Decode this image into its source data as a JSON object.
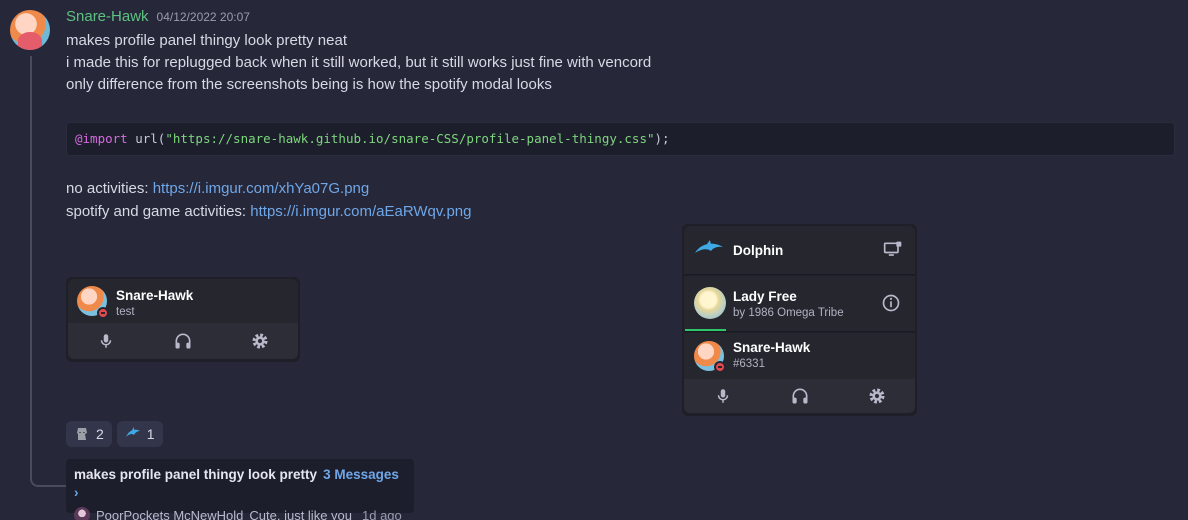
{
  "message": {
    "username": "Snare-Hawk",
    "timestamp": "04/12/2022 20:07",
    "lines": [
      "makes profile panel thingy look pretty neat",
      "i made this for replugged back when it still worked, but it still works just fine with vencord",
      "only difference from the screenshots being is how the spotify modal looks"
    ],
    "code": {
      "keyword": "@import",
      "fn_open": " url(",
      "string": "\"https://snare-hawk.github.io/snare-CSS/profile-panel-thingy.css\"",
      "fn_close": ");"
    },
    "links": [
      {
        "label": "no activities: ",
        "url": "https://i.imgur.com/xhYa07G.png"
      },
      {
        "label": "spotify and game activities: ",
        "url": "https://i.imgur.com/aEaRWqv.png"
      }
    ]
  },
  "panel_small": {
    "name": "Snare-Hawk",
    "status": "test"
  },
  "panel_big": {
    "game": "Dolphin",
    "song": "Lady Free",
    "artist": "by 1986 Omega Tribe",
    "progress": 0.18,
    "name": "Snare-Hawk",
    "tag": "#6331"
  },
  "reactions": [
    {
      "emoji": "stone-moai-icon",
      "count": "2"
    },
    {
      "emoji": "dolphin-icon",
      "count": "1"
    }
  ],
  "thread": {
    "title": "makes profile panel thingy look pretty",
    "count": "3 Messages ›",
    "last_author": "PoorPockets McNewHold",
    "last_message": "Cute, just like you",
    "ago": "1d ago"
  },
  "colors": {
    "background": "#262738",
    "username": "#5dc282",
    "link": "#6fa7e8",
    "progress": "#2dc76a",
    "dnd": "#e5484d"
  }
}
